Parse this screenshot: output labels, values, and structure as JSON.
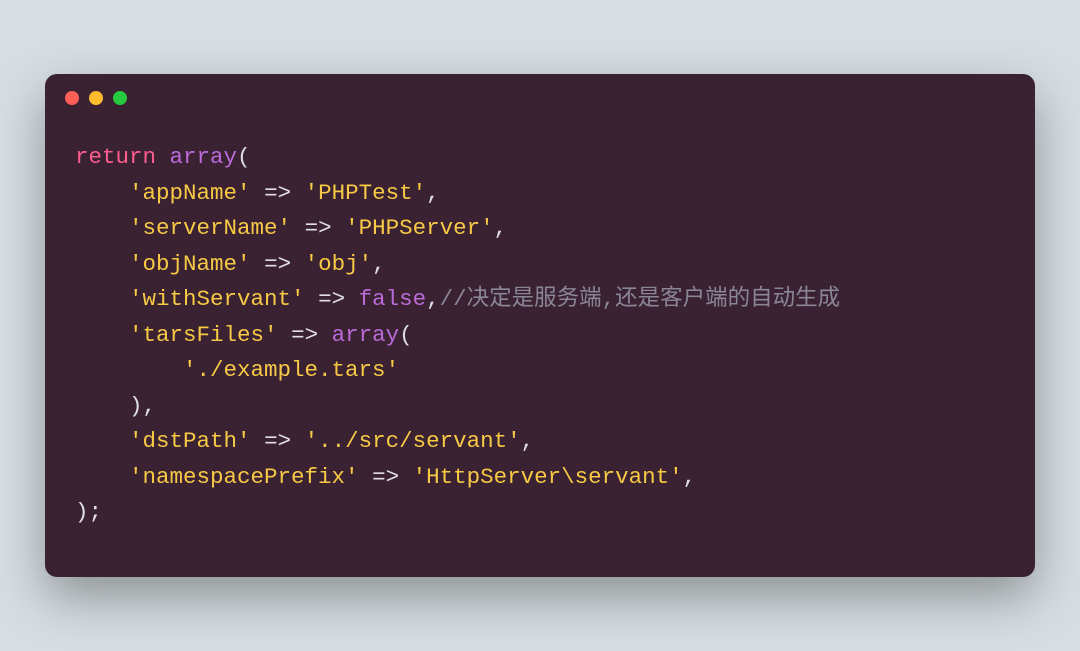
{
  "line1": {
    "return": "return",
    "array": "array",
    "open": "("
  },
  "line2": {
    "key": "'appName'",
    "arrow": "=>",
    "val": "'PHPTest'",
    "end": ","
  },
  "line3": {
    "key": "'serverName'",
    "arrow": "=>",
    "val": "'PHPServer'",
    "end": ","
  },
  "line4": {
    "key": "'objName'",
    "arrow": "=>",
    "val": "'obj'",
    "end": ","
  },
  "line5": {
    "key": "'withServant'",
    "arrow": "=>",
    "val": "false",
    "end": ",",
    "cmt": "//决定是服务端,还是客户端的自动生成"
  },
  "line6": {
    "key": "'tarsFiles'",
    "arrow": "=>",
    "array": "array",
    "open": "("
  },
  "line7": {
    "val": "'./example.tars'"
  },
  "line8": {
    "close": "),"
  },
  "line9": {
    "key": "'dstPath'",
    "arrow": "=>",
    "val": "'../src/servant'",
    "end": ","
  },
  "line10": {
    "key": "'namespacePrefix'",
    "arrow": "=>",
    "val": "'HttpServer\\servant'",
    "end": ","
  },
  "line11": {
    "close": ");"
  }
}
